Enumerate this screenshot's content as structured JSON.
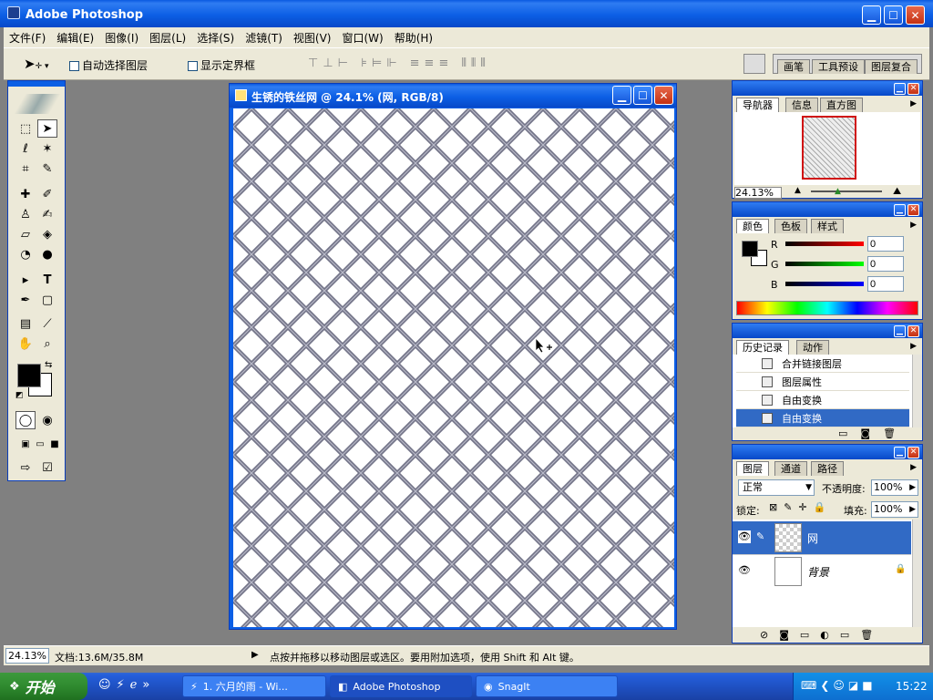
{
  "app": {
    "title": "Adobe Photoshop"
  },
  "menu": [
    "文件(F)",
    "编辑(E)",
    "图像(I)",
    "图层(L)",
    "选择(S)",
    "滤镜(T)",
    "视图(V)",
    "窗口(W)",
    "帮助(H)"
  ],
  "options": {
    "auto_select": "自动选择图层",
    "show_bounds": "显示定界框"
  },
  "palette_tabs": [
    "画笔",
    "工具预设",
    "图层复合"
  ],
  "document": {
    "title": "生锈的铁丝网 @ 24.1% (网, RGB/8)"
  },
  "navigator": {
    "tabs": [
      "导航器",
      "信息",
      "直方图"
    ],
    "zoom": "24.13%"
  },
  "color": {
    "tabs": [
      "颜色",
      "色板",
      "样式"
    ],
    "r_label": "R",
    "g_label": "G",
    "b_label": "B",
    "r": "0",
    "g": "0",
    "b": "0"
  },
  "history": {
    "tabs": [
      "历史记录",
      "动作"
    ],
    "items": [
      "合并链接图层",
      "图层属性",
      "自由变换",
      "自由变换"
    ]
  },
  "layers": {
    "tabs": [
      "图层",
      "通道",
      "路径"
    ],
    "blend_mode": "正常",
    "opacity_label": "不透明度:",
    "opacity": "100%",
    "lock_label": "锁定:",
    "fill_label": "填充:",
    "fill": "100%",
    "rows": [
      {
        "name": "网"
      },
      {
        "name": "背景"
      }
    ]
  },
  "status": {
    "zoom": "24.13%",
    "doc_size": "文档:13.6M/35.8M",
    "hint": "点按并拖移以移动图层或选区。要用附加选项，使用 Shift 和 Alt 键。"
  },
  "taskbar": {
    "start": "开始",
    "items": [
      "1. 六月的雨 - Wi...",
      "Adobe Photoshop",
      "SnagIt"
    ],
    "time": "15:22"
  },
  "colors": {
    "title_blue": "#0c5fe5",
    "selected": "#316ac5",
    "bg_gray": "#808080"
  }
}
